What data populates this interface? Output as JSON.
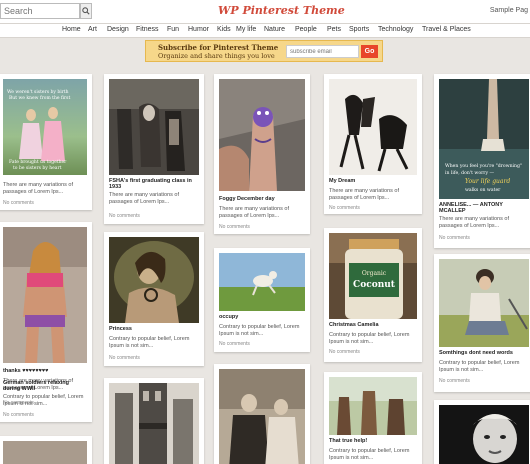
{
  "header": {
    "search_placeholder": "Search",
    "logo_text": "WP Pinterest Theme",
    "user_name": "Sample Pag"
  },
  "nav": {
    "items": [
      "Home",
      "Art",
      "Design",
      "Fitness",
      "Fun",
      "Humor",
      "Kids",
      "My life",
      "Nature",
      "People",
      "Pets",
      "Sports",
      "Technology",
      "Travel & Places"
    ]
  },
  "subscribe": {
    "title": "Subscribe for Pinterest Theme",
    "description": "Organize and share things you love",
    "email_placeholder": "subscribe email",
    "button": "Go"
  },
  "pins": [
    {
      "title": "",
      "desc": "There are many variations of passages of Lorem Ips...",
      "comments": "No comments",
      "image_text": "We weren't sisters by birth",
      "image_text2": "But we knew from the first",
      "image_text3": "Fate brought us together",
      "image_text4": "to be sisters by heart"
    },
    {
      "title": "thanks ♥♥♥♥♥♥♥♥",
      "desc": "There are many variations of passages of Lorem Ips...",
      "comments": "No comments"
    },
    {
      "title": "German soldiers relaxing during WWII",
      "desc": "Contrary to popular belief, Lorem Ipsum is not sim...",
      "comments": "No comments"
    },
    {
      "title": "",
      "desc": "",
      "comments": ""
    },
    {
      "title": "FSHA's first graduating class in 1933",
      "desc": "There are many variations of passages of Lorem Ips...",
      "comments": "No comments"
    },
    {
      "title": "Princess",
      "desc": "Contrary to popular belief, Lorem Ipsum is not sim...",
      "comments": "No comments"
    },
    {
      "title": "",
      "desc": "",
      "comments": ""
    },
    {
      "title": "Foggy December day",
      "desc": "There are many variations of passages of Lorem Ips...",
      "comments": "No comments"
    },
    {
      "title": "occupy",
      "desc": "Contrary to popular belief, Lorem Ipsum is not sim...",
      "comments": "No comments"
    },
    {
      "title": "",
      "desc": "",
      "comments": ""
    },
    {
      "title": "My Dream",
      "desc": "There are many variations of passages of Lorem Ips...",
      "comments": "No comments"
    },
    {
      "title": "Christmas Camelia",
      "desc": "Contrary to popular belief, Lorem Ipsum is not sim...",
      "comments": "No comments",
      "jar_text": "Coconut",
      "jar_sub": "Organic"
    },
    {
      "title": "That true help!",
      "desc": "Contrary to popular belief, Lorem Ipsum is not sim...",
      "comments": "No comments"
    },
    {
      "title": "ANNELISE... — ANTONY MCALLEP",
      "desc": "There are many variations of passages of Lorem Ips...",
      "comments": "No comments",
      "image_text": "When you feel you're \"drowning\"",
      "image_text2": "in life, don't worry —",
      "image_text3": "Your life guard",
      "image_text4": "walks on water"
    },
    {
      "title": "Somthings dont need words",
      "desc": "Contrary to popular belief, Lorem Ipsum is not sim...",
      "comments": "No comments"
    },
    {
      "title": "",
      "desc": "",
      "comments": ""
    }
  ],
  "colors": {
    "accent": "#d14a3a",
    "subscribe_bg": "#f6d78a",
    "go_button": "#e8462a",
    "page_bg": "#e9e6e2"
  }
}
